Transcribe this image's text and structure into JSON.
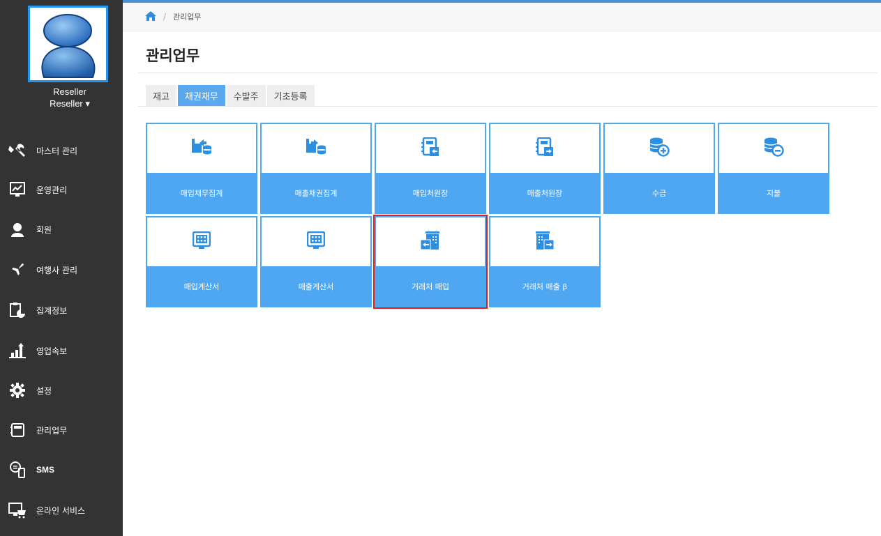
{
  "user": {
    "name": "Reseller",
    "role": "Reseller ▾"
  },
  "sidebar": {
    "items": [
      {
        "label": "마스터 관리",
        "icon": "tools-icon"
      },
      {
        "label": "운영관리",
        "icon": "chart-monitor-icon"
      },
      {
        "label": "회원",
        "icon": "person-icon"
      },
      {
        "label": "여행사 관리",
        "icon": "airplane-icon"
      },
      {
        "label": "집계정보",
        "icon": "clipboard-pie-icon"
      },
      {
        "label": "영업속보",
        "icon": "bar-chart-icon"
      },
      {
        "label": "설정",
        "icon": "gear-icon"
      },
      {
        "label": "관리업무",
        "icon": "notebook-icon"
      },
      {
        "label": "SMS",
        "icon": "phone-message-icon"
      },
      {
        "label": "온라인 서비스",
        "icon": "monitor-cart-icon"
      }
    ]
  },
  "breadcrumb": {
    "home_icon": "home-icon",
    "current": "관리업무"
  },
  "page": {
    "title": "관리업무"
  },
  "tabs": [
    {
      "label": "재고",
      "active": false
    },
    {
      "label": "채권채무",
      "active": true
    },
    {
      "label": "수발주",
      "active": false
    },
    {
      "label": "기초등록",
      "active": false
    }
  ],
  "tiles": [
    {
      "label": "매입채무집계",
      "icon": "transfer-db-icon"
    },
    {
      "label": "매출채권집계",
      "icon": "transfer-db-icon"
    },
    {
      "label": "매입처원장",
      "icon": "ledger-in-icon"
    },
    {
      "label": "매출처원장",
      "icon": "ledger-out-icon"
    },
    {
      "label": "수금",
      "icon": "coins-plus-icon"
    },
    {
      "label": "지불",
      "icon": "coins-minus-icon"
    },
    {
      "label": "매입계산서",
      "icon": "calculator-screen-icon"
    },
    {
      "label": "매출계산서",
      "icon": "calculator-screen-icon"
    },
    {
      "label": "거래처 매입",
      "icon": "building-in-icon",
      "highlighted": true
    },
    {
      "label": "거래처 매출 β",
      "icon": "building-out-icon"
    }
  ],
  "colors": {
    "accent": "#4ea7f0",
    "sidebar": "#333333",
    "highlight": "#e02020"
  }
}
